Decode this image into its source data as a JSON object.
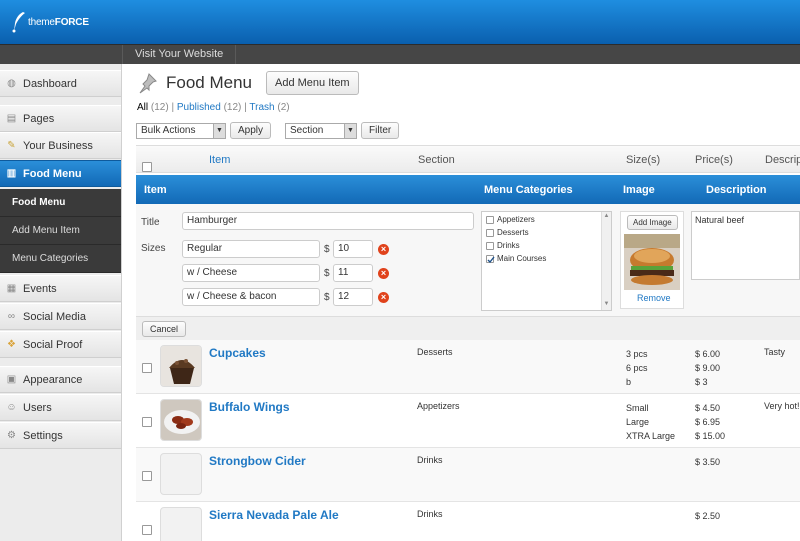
{
  "brand": {
    "logo_prefix": "theme",
    "logo_suffix": "FORCE"
  },
  "adminbar": {
    "visit": "Visit Your Website"
  },
  "sidebar": {
    "items": [
      {
        "label": "Dashboard",
        "icon": "dashboard-icon"
      },
      {
        "label": "Pages",
        "icon": "pages-icon"
      },
      {
        "label": "Your Business",
        "icon": "pencil-icon"
      },
      {
        "label": "Food Menu",
        "icon": "book-icon"
      },
      {
        "label": "Events",
        "icon": "calendar-icon"
      },
      {
        "label": "Social Media",
        "icon": "link-icon"
      },
      {
        "label": "Social Proof",
        "icon": "chat-icon"
      },
      {
        "label": "Appearance",
        "icon": "appearance-icon"
      },
      {
        "label": "Users",
        "icon": "users-icon"
      },
      {
        "label": "Settings",
        "icon": "settings-icon"
      }
    ],
    "submenu": [
      "Food Menu",
      "Add Menu Item",
      "Menu Categories"
    ]
  },
  "page": {
    "title": "Food Menu",
    "add_button": "Add Menu Item"
  },
  "filters": {
    "all": "All",
    "all_count": "(12)",
    "published": "Published",
    "published_count": "(12)",
    "trash": "Trash",
    "trash_count": "(2)",
    "sep": "|"
  },
  "toolbar": {
    "bulk": "Bulk Actions",
    "apply": "Apply",
    "section": "Section",
    "filter": "Filter"
  },
  "columns": {
    "item": "Item",
    "section": "Section",
    "sizes": "Size(s)",
    "prices": "Price(s)",
    "desc": "Descript"
  },
  "edit": {
    "headers": {
      "item": "Item",
      "categories": "Menu Categories",
      "image": "Image",
      "description": "Description"
    },
    "title_label": "Title",
    "title_value": "Hamburger",
    "sizes_label": "Sizes",
    "currency": "$",
    "sizes": [
      {
        "name": "Regular",
        "price": "10"
      },
      {
        "name": "w / Cheese",
        "price": "11"
      },
      {
        "name": "w / Cheese & bacon",
        "price": "12"
      }
    ],
    "categories": [
      {
        "label": "Appetizers",
        "checked": false
      },
      {
        "label": "Desserts",
        "checked": false
      },
      {
        "label": "Drinks",
        "checked": false
      },
      {
        "label": "Main Courses",
        "checked": true
      }
    ],
    "add_image": "Add Image",
    "remove": "Remove",
    "description": "Natural beef",
    "cancel": "Cancel"
  },
  "rows": [
    {
      "name": "Cupcakes",
      "section": "Desserts",
      "sizes": [
        "3 pcs",
        "6 pcs",
        "b"
      ],
      "prices": [
        "$ 6.00",
        "$ 9.00",
        "$ 3"
      ],
      "desc": "Tasty",
      "thumb": "cupcake"
    },
    {
      "name": "Buffalo Wings",
      "section": "Appetizers",
      "sizes": [
        "Small",
        "Large",
        "XTRA Large"
      ],
      "prices": [
        "$ 4.50",
        "$ 6.95",
        "$ 15.00"
      ],
      "desc": "Very hot!",
      "thumb": "wings"
    },
    {
      "name": "Strongbow Cider",
      "section": "Drinks",
      "sizes": [],
      "prices": [
        "$ 3.50"
      ],
      "desc": "",
      "thumb": "none"
    },
    {
      "name": "Sierra Nevada Pale Ale",
      "section": "Drinks",
      "sizes": [],
      "prices": [
        "$ 2.50"
      ],
      "desc": "",
      "thumb": "none"
    }
  ],
  "colors": {
    "accent": "#1a7bcc",
    "link": "#2179c4",
    "delete": "#e0421b"
  }
}
